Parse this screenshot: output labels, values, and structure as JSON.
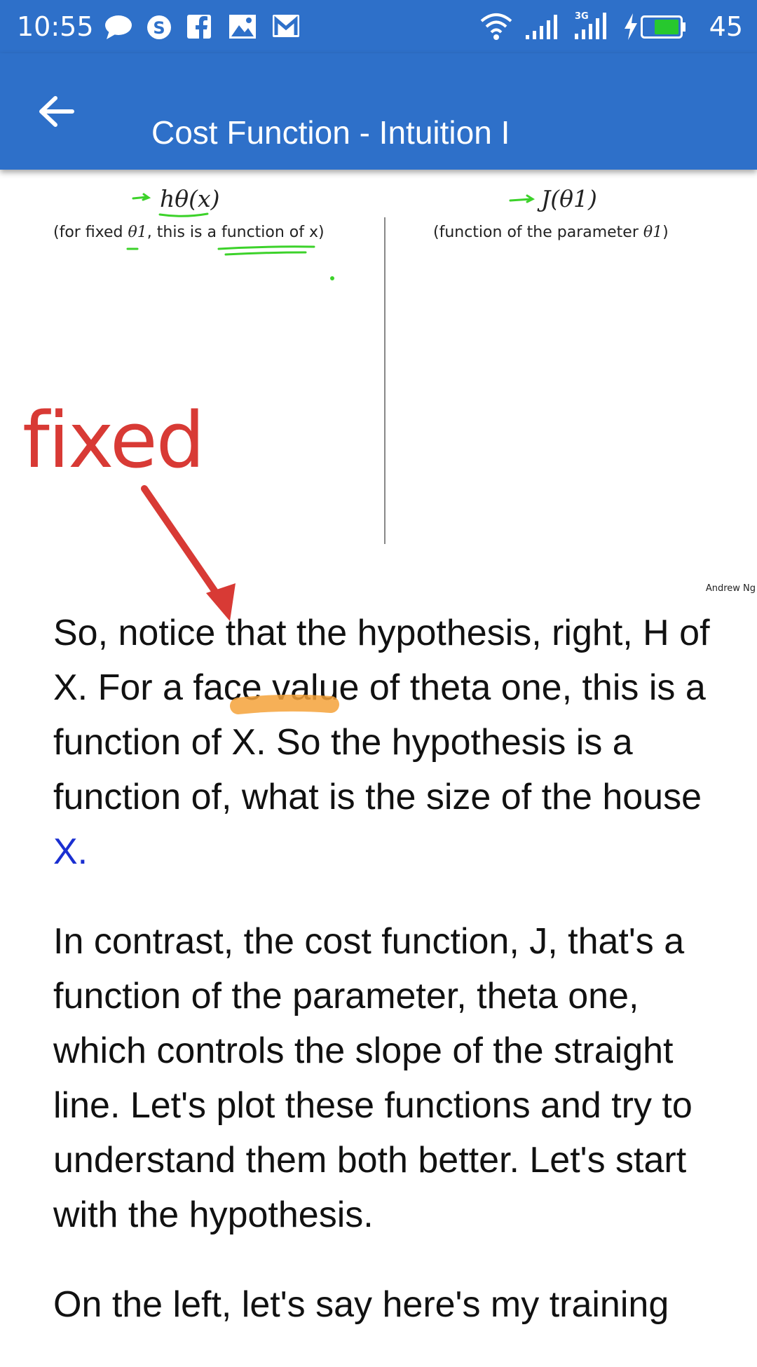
{
  "status_bar": {
    "time": "10:55",
    "notification_icons": [
      "chat-bubble-icon",
      "skype-icon",
      "facebook-icon",
      "gallery-icon",
      "gmail-icon"
    ],
    "system_icons": [
      "wifi-icon",
      "signal-icon",
      "signal-3g-icon",
      "charging-icon",
      "battery-icon"
    ],
    "network_label": "3G",
    "battery_level": "45",
    "background": "#2e70c9"
  },
  "app_bar": {
    "title": "Cost Function - Intuition I",
    "back_icon": "arrow-left-icon",
    "background": "#2e70c9"
  },
  "slide": {
    "left_heading": "hθ(x)",
    "left_caption_prefix": "(for fixed ",
    "left_caption_theta": "θ1",
    "left_caption_suffix": ", this is a function of x)",
    "right_heading": "J(θ1)",
    "right_caption_prefix": "(function of the parameter ",
    "right_caption_theta": "θ1",
    "right_caption_suffix": ")",
    "credit": "Andrew Ng",
    "annotation_word": "fixed",
    "annotation_color": "#d83a35",
    "pen_color": "#3cd22a",
    "highlighter_color": "#f5a23a"
  },
  "transcript": {
    "paragraph_1": "So, notice that the hypothesis, right, H of X.  For a face value of theta one, this is a function of X.  So the hypothesis is a function of, what is the size of the house ",
    "paragraph_1_highlight": "X.",
    "paragraph_2": "In contrast, the cost function, J, that's a function of the parameter, theta one, which controls the slope of the straight line.  Let's plot these functions and try to understand them both better.  Let's start with the hypothesis.",
    "paragraph_3": "On the left, let's say here's my training",
    "highlight_color": "#1a2fd1"
  }
}
